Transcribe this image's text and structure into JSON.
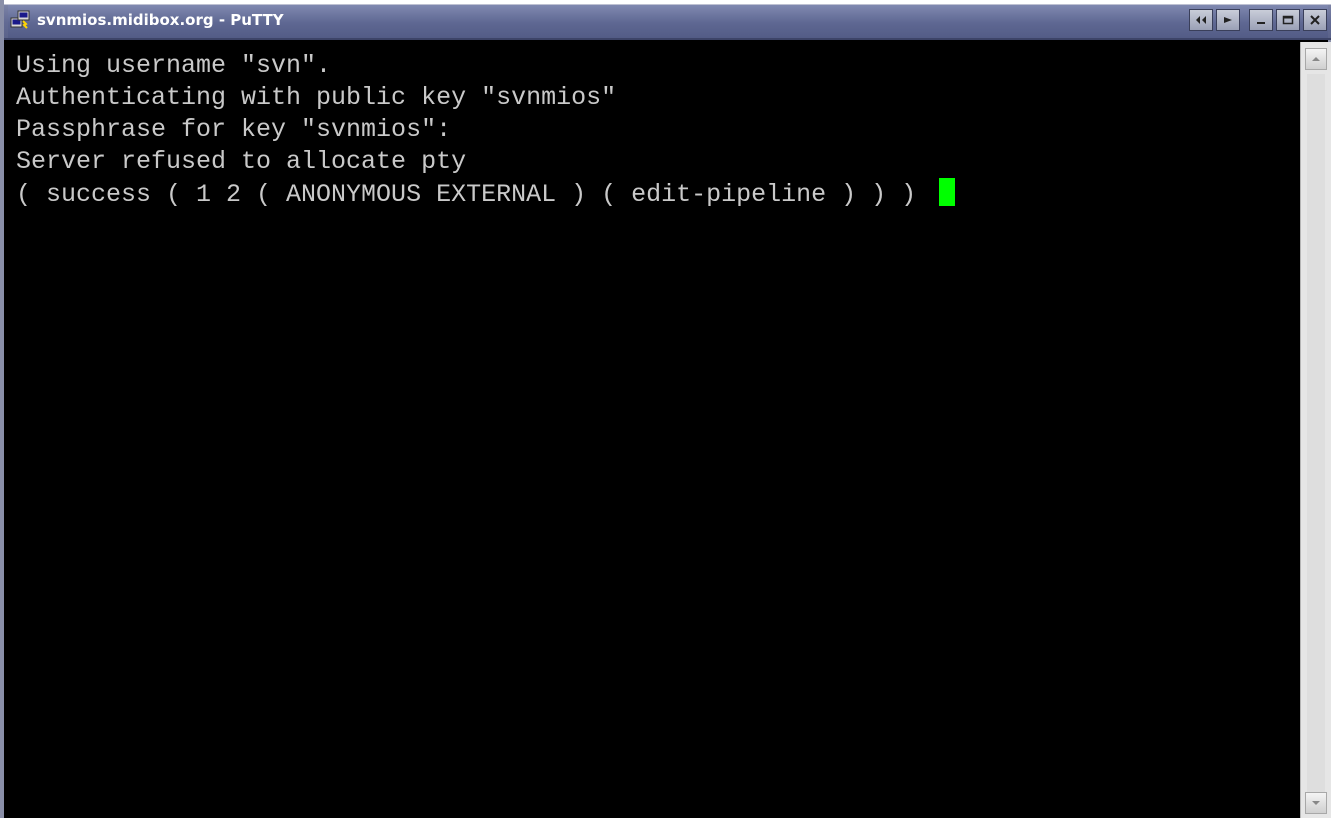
{
  "window": {
    "title": "svnmios.midibox.org - PuTTY",
    "app_icon": "putty-terminal-icon",
    "buttons": [
      "tile-left-icon",
      "tile-right-icon",
      "minimize-icon",
      "maximize-icon",
      "close-icon"
    ]
  },
  "terminal": {
    "lines": [
      "Using username \"svn\".",
      "Authenticating with public key \"svnmios\"",
      "Passphrase for key \"svnmios\":",
      "Server refused to allocate pty",
      "( success ( 1 2 ( ANONYMOUS EXTERNAL ) ( edit-pipeline ) ) ) "
    ],
    "cursor_color": "#00ff00",
    "text_color": "#c9c9c9",
    "background": "#000000"
  }
}
